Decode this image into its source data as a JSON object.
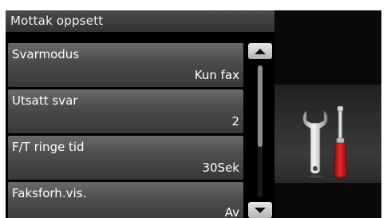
{
  "header": {
    "title": "Mottak oppsett"
  },
  "menu": {
    "items": [
      {
        "label": "Svarmodus",
        "value": "Kun fax"
      },
      {
        "label": "Utsatt svar",
        "value": "2"
      },
      {
        "label": "F/T ringe tid",
        "value": "30Sek"
      },
      {
        "label": "Faksforh.vis.",
        "value": "Av"
      }
    ]
  },
  "scrollbar": {
    "up_icon": "triangle-up-icon",
    "down_icon": "triangle-down-icon",
    "thumb_fraction": 0.62,
    "thumb_start": 0
  },
  "illustration": {
    "icon": "wrench-screwdriver-icon"
  },
  "colors": {
    "header_bg": "#3c3c3c",
    "item_bg": "#4d4d4d",
    "text": "#ffffff",
    "screwdriver_handle": "#d01818"
  }
}
